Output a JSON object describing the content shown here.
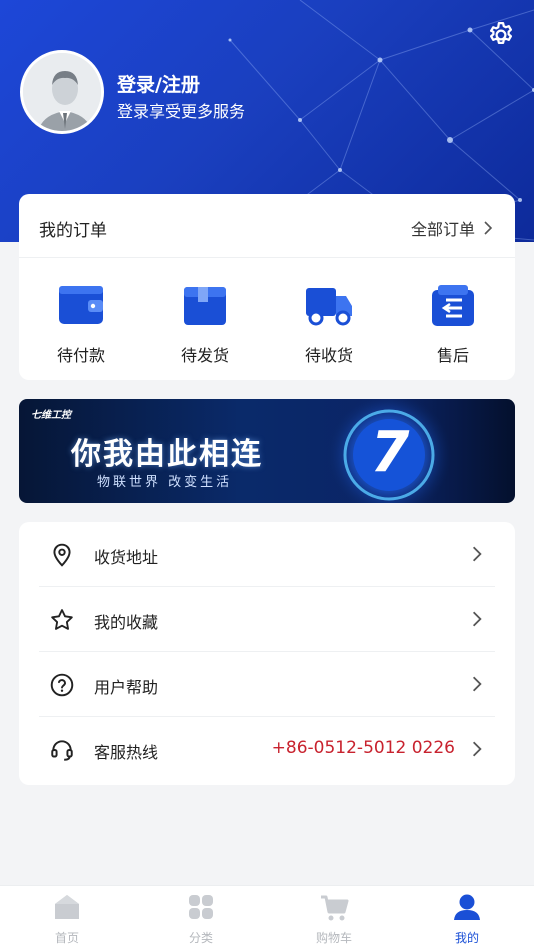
{
  "colors": {
    "primary": "#1a4fd6",
    "hotline": "#c8222e",
    "inactive_tab": "#c9ccd1"
  },
  "header": {
    "login_title": "登录/注册",
    "login_subtitle": "登录享受更多服务"
  },
  "orders": {
    "title": "我的订单",
    "all_label": "全部订单",
    "items": [
      {
        "label": "待付款",
        "icon": "wallet-icon"
      },
      {
        "label": "待发货",
        "icon": "package-icon"
      },
      {
        "label": "待收货",
        "icon": "truck-icon"
      },
      {
        "label": "售后",
        "icon": "return-icon"
      }
    ]
  },
  "banner": {
    "brand": "七维工控",
    "slogan": "你我由此相连",
    "subtitle": "物联世界 改变生活",
    "emblem": "7"
  },
  "menu": [
    {
      "label": "收货地址",
      "icon": "location-pin-icon"
    },
    {
      "label": "我的收藏",
      "icon": "star-icon"
    },
    {
      "label": "用户帮助",
      "icon": "help-circle-icon"
    },
    {
      "label": "客服热线",
      "icon": "headset-icon",
      "value": "+86-0512-5012 0226"
    }
  ],
  "tabbar": [
    {
      "label": "首页",
      "icon": "home-icon"
    },
    {
      "label": "分类",
      "icon": "category-grid-icon"
    },
    {
      "label": "购物车",
      "icon": "cart-icon"
    },
    {
      "label": "我的",
      "icon": "user-icon",
      "active": true
    }
  ]
}
